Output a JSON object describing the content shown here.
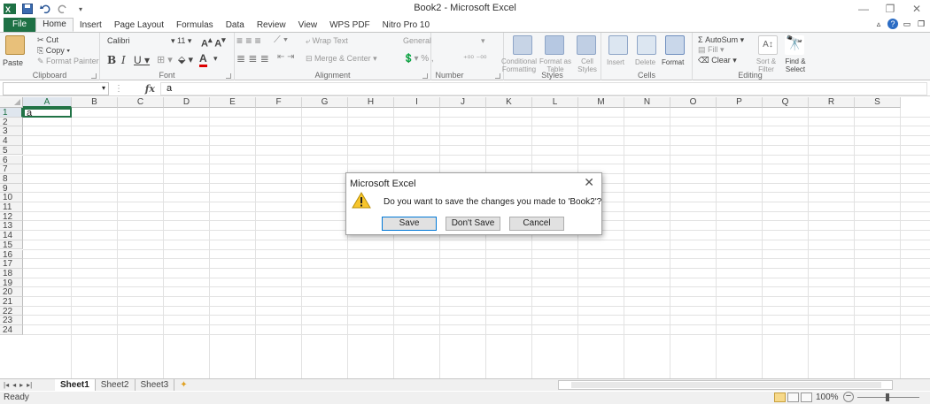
{
  "window": {
    "title": "Book2 - Microsoft Excel"
  },
  "ribbon_tabs": [
    "File",
    "Home",
    "Insert",
    "Page Layout",
    "Formulas",
    "Data",
    "Review",
    "View",
    "WPS PDF",
    "Nitro Pro 10"
  ],
  "ribbon": {
    "clipboard": {
      "paste": "Paste",
      "cut": "Cut",
      "copy": "Copy",
      "format_painter": "Format Painter",
      "label": "Clipboard"
    },
    "font": {
      "name": "Calibri",
      "size": "11",
      "label": "Font"
    },
    "alignment": {
      "wrap": "Wrap Text",
      "merge": "Merge & Center",
      "label": "Alignment"
    },
    "number": {
      "format": "General",
      "label": "Number"
    },
    "styles": {
      "conditional": "Conditional Formatting",
      "format_table": "Format as Table",
      "cell_styles": "Cell Styles",
      "label": "Styles"
    },
    "cells": {
      "insert": "Insert",
      "delete": "Delete",
      "format": "Format",
      "label": "Cells"
    },
    "editing": {
      "autosum": "AutoSum",
      "fill": "Fill",
      "clear": "Clear",
      "sort": "Sort & Filter",
      "find": "Find & Select",
      "label": "Editing"
    }
  },
  "formula_bar": {
    "fx": "fx",
    "value": "a"
  },
  "columns": [
    "A",
    "B",
    "C",
    "D",
    "E",
    "F",
    "G",
    "H",
    "I",
    "J",
    "K",
    "L",
    "M",
    "N",
    "O",
    "P",
    "Q",
    "R",
    "S"
  ],
  "rows": [
    "1",
    "2",
    "3",
    "4",
    "5",
    "6",
    "7",
    "8",
    "9",
    "10",
    "11",
    "12",
    "13",
    "14",
    "15",
    "16",
    "17",
    "18",
    "19",
    "20",
    "21",
    "22",
    "23",
    "24"
  ],
  "cells": {
    "A1": "a"
  },
  "sheets": [
    "Sheet1",
    "Sheet2",
    "Sheet3"
  ],
  "status": {
    "ready": "Ready",
    "zoom": "100%"
  },
  "dialog": {
    "title": "Microsoft Excel",
    "message": "Do you want to save the changes you made to 'Book2'?",
    "save": "Save",
    "dont_save": "Don't Save",
    "cancel": "Cancel"
  },
  "colors": {
    "excel_green": "#217346",
    "file_tab": "#1e7145"
  }
}
